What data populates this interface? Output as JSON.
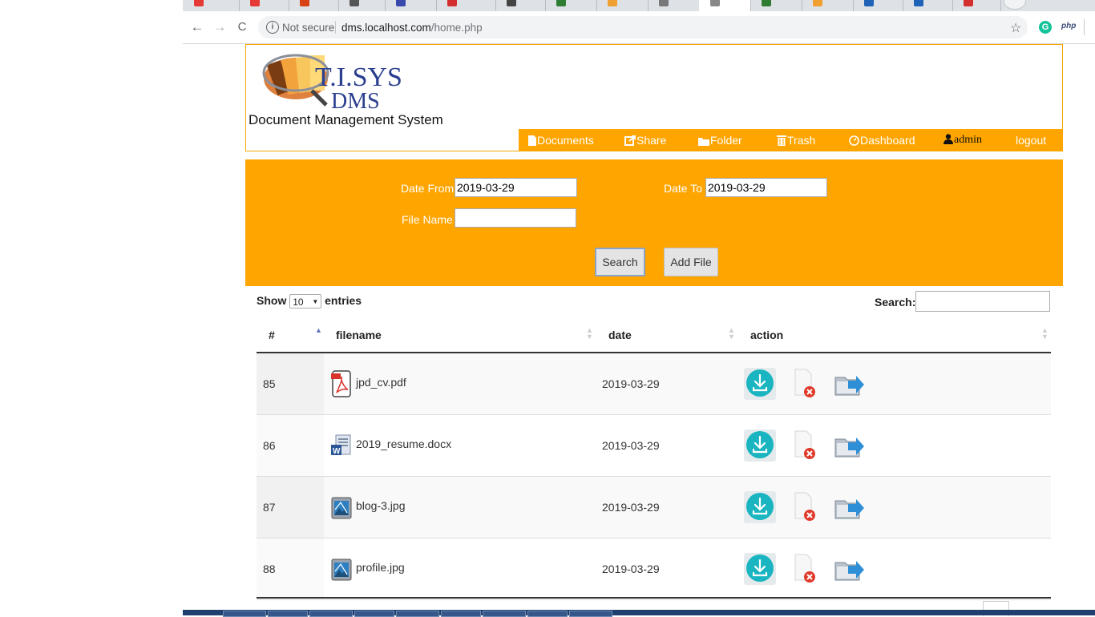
{
  "browser": {
    "security_label": "Not secure",
    "url_host": "dms.localhost.com",
    "url_path": "/home.php",
    "ext_php_label": "php"
  },
  "header": {
    "logo_text_top": "T.I.SYS",
    "logo_text_bottom": "DMS",
    "subtitle": "Document Management System"
  },
  "nav": [
    {
      "label": "Documents",
      "icon": "file-icon"
    },
    {
      "label": "Share",
      "icon": "share-icon"
    },
    {
      "label": "Folder",
      "icon": "folder-icon"
    },
    {
      "label": "Trash",
      "icon": "trash-icon"
    },
    {
      "label": "Dashboard",
      "icon": "dashboard-icon"
    },
    {
      "label": "admin",
      "icon": "user-icon"
    },
    {
      "label": "logout",
      "icon": ""
    }
  ],
  "search_form": {
    "date_from_label": "Date From :",
    "date_from_value": "2019-03-29",
    "date_to_label": "Date To :",
    "date_to_value": "2019-03-29",
    "file_name_label": "File Name :",
    "file_name_value": "",
    "search_button": "Search",
    "add_file_button": "Add File"
  },
  "datatable": {
    "show_label": "Show",
    "entries_value": "10",
    "entries_label": "entries",
    "search_label": "Search:",
    "columns": [
      "#",
      "filename",
      "date",
      "action"
    ],
    "rows": [
      {
        "id": "85",
        "filename": "jpd_cv.pdf",
        "type": "pdf",
        "date": "2019-03-29"
      },
      {
        "id": "86",
        "filename": "2019_resume.docx",
        "type": "docx",
        "date": "2019-03-29"
      },
      {
        "id": "87",
        "filename": "blog-3.jpg",
        "type": "image",
        "date": "2019-03-29"
      },
      {
        "id": "88",
        "filename": "profile.jpg",
        "type": "image",
        "date": "2019-03-29"
      }
    ]
  },
  "colors": {
    "accent": "#ffa500",
    "download_button": "#1ab5c0",
    "delete_badge": "#e03a2a"
  }
}
